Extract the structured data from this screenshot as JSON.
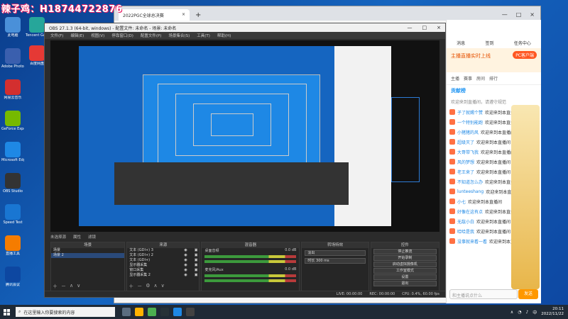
{
  "watermark": "辣子鸡：H18744722876",
  "desktop_icons": [
    {
      "label": "此电脑",
      "color": "#4a90d9"
    },
    {
      "label": "Adobe Photoshop",
      "color": "#3a5fae"
    },
    {
      "label": "网易云音乐",
      "color": "#d32f2f"
    },
    {
      "label": "GeForce Experience",
      "color": "#76b900"
    },
    {
      "label": "Microsoft Edge",
      "color": "#1e88e5"
    },
    {
      "label": "OBS Studio",
      "color": "#333333"
    },
    {
      "label": "Speed Test",
      "color": "#1976d2"
    },
    {
      "label": "直播工具",
      "color": "#f57c00"
    },
    {
      "label": "腾讯会议",
      "color": "#0d47a1"
    }
  ],
  "desktop_icons2": [
    {
      "label": "Tencent Game",
      "color": "#26a69a"
    },
    {
      "label": "百度网盘",
      "color": "#e53935"
    }
  ],
  "browser": {
    "tab_title": "2022PGC全球总决赛",
    "tab_close": "×",
    "new_tab": "+",
    "win_controls": [
      "—",
      "□",
      "×"
    ]
  },
  "right_panel": {
    "top_nav": [
      "消息",
      "签到",
      "任务中心",
      "PC客户端"
    ],
    "banner_title": "PC客户端",
    "banner_sub": "主播直播实时上线",
    "tabs": [
      "主播",
      "赛事",
      "房间",
      "排行"
    ],
    "section_title": "贡献榜",
    "notice": "欢迎来到直播间，请遵守规范",
    "chat": [
      {
        "name": "子了就赐个赞",
        "msg": "欢迎来到本直播间"
      },
      {
        "name": "一个特别能跑",
        "msg": "欢迎来到本直播间"
      },
      {
        "name": "小猪猪的风",
        "msg": "欢迎来到本直播间"
      },
      {
        "name": "超级灭了",
        "msg": "欢迎来到本直播间"
      },
      {
        "name": "大哥带飞我",
        "msg": "欢迎来到本直播间"
      },
      {
        "name": "风的梦想",
        "msg": "欢迎来到本直播间"
      },
      {
        "name": "老王来了",
        "msg": "欢迎来到本直播间"
      },
      {
        "name": "不知道怎么办",
        "msg": "欢迎来到本直播间"
      },
      {
        "name": "lunteeshang",
        "msg": "欢迎来到本直播间"
      },
      {
        "name": "小七",
        "msg": "欢迎来到本直播间"
      },
      {
        "name": "好像在这有点",
        "msg": "欢迎来到本直播间"
      },
      {
        "name": "无敌小白",
        "msg": "欢迎来到本直播间"
      },
      {
        "name": "哈哈是我",
        "msg": "欢迎来到本直播间"
      },
      {
        "name": "没事就来看一看",
        "msg": "欢迎来到本直播间"
      }
    ],
    "input_placeholder": "和主播说点什么",
    "send_label": "发送"
  },
  "obs": {
    "title": "OBS 27.1.3 (64-bit, windows) - 配置文件: 未命名 - 场景: 未命名",
    "win_controls": [
      "—",
      "□",
      "×"
    ],
    "menu": [
      "文件(F)",
      "编辑(E)",
      "视图(V)",
      "停靠窗口(D)",
      "配置文件(P)",
      "场景集合(S)",
      "工具(T)",
      "帮助(H)"
    ],
    "scene_bar": [
      "未选择源",
      "属性",
      "滤镜"
    ],
    "scenes": {
      "title": "场景",
      "items": [
        "场景",
        "场景 2"
      ],
      "selected": 1
    },
    "sources": {
      "title": "来源",
      "items": [
        "文本 (GDI+) 3",
        "文本 (GDI+) 2",
        "文本 (GDI+)",
        "显示器采集",
        "窗口采集",
        "显示器采集 2"
      ]
    },
    "mixer": {
      "title": "混音器",
      "channels": [
        {
          "name": "桌面音频",
          "db": "0.0 dB"
        },
        {
          "name": "麦克风/Aux",
          "db": "0.0 dB"
        }
      ]
    },
    "transitions": {
      "title": "转场特效",
      "type": "淡出",
      "duration_label": "时长",
      "duration": "300 ms"
    },
    "controls": {
      "title": "控件",
      "buttons": [
        "停止推流",
        "开始录制",
        "启动虚拟摄像机",
        "工作室模式",
        "设置",
        "退出"
      ]
    },
    "status": {
      "live": "LIVE: 00:00:00",
      "rec": "REC: 00:00:00",
      "cpu": "CPU: 0.4%, 60.00 fps"
    }
  },
  "taskbar": {
    "search_placeholder": "在这里输入你要搜索的内容",
    "time": "20:11",
    "date": "2022/11/22",
    "lang": "中"
  }
}
